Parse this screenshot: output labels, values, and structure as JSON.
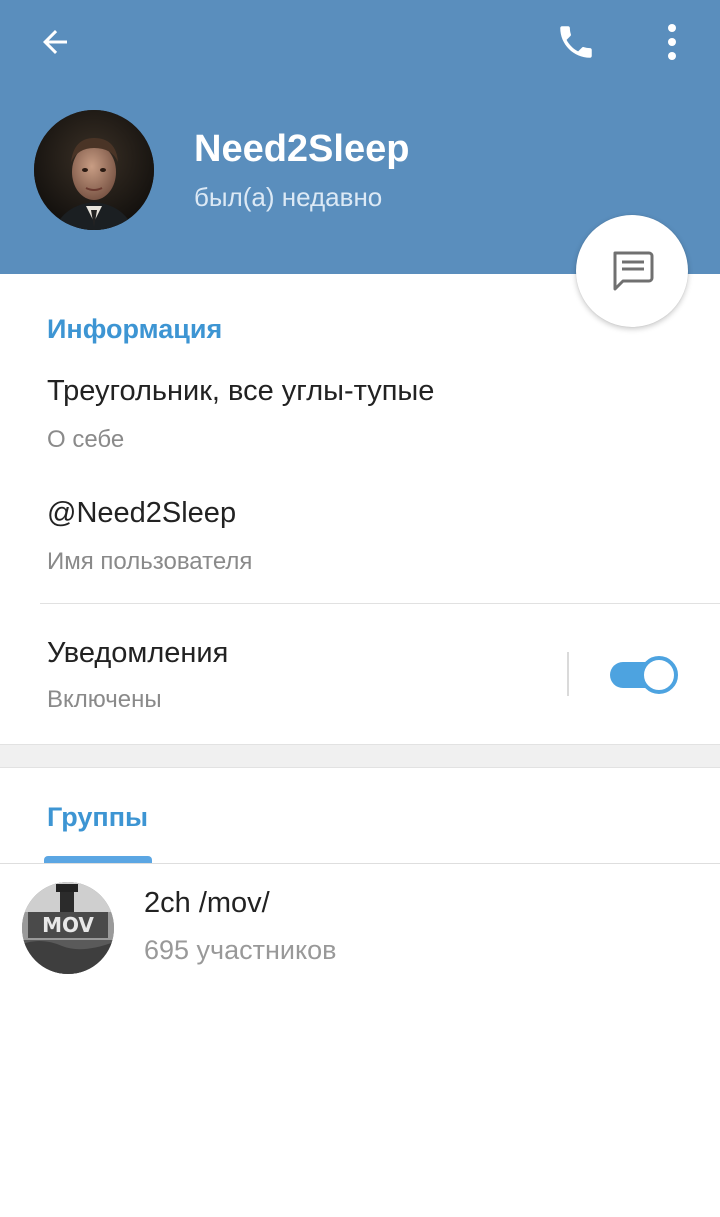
{
  "colors": {
    "header_bg": "#5a8ebd",
    "accent": "#3d95d3",
    "toggle": "#4da3e0"
  },
  "header": {
    "back_icon": "arrow-left-icon",
    "call_icon": "phone-icon",
    "menu_icon": "more-vertical-icon"
  },
  "profile": {
    "name": "Need2Sleep",
    "status": "был(а) недавно"
  },
  "fab": {
    "icon": "message-icon"
  },
  "info": {
    "section_title": "Информация",
    "about_value": "Треугольник, все углы-тупые",
    "about_label": "О себе",
    "username_value": "@Need2Sleep",
    "username_label": "Имя пользователя",
    "notifications_value": "Уведомления",
    "notifications_label": "Включены",
    "notifications_enabled": true
  },
  "groups": {
    "section_title": "Группы",
    "items": [
      {
        "name": "2ch /mov/",
        "members": "695 участников"
      }
    ]
  }
}
